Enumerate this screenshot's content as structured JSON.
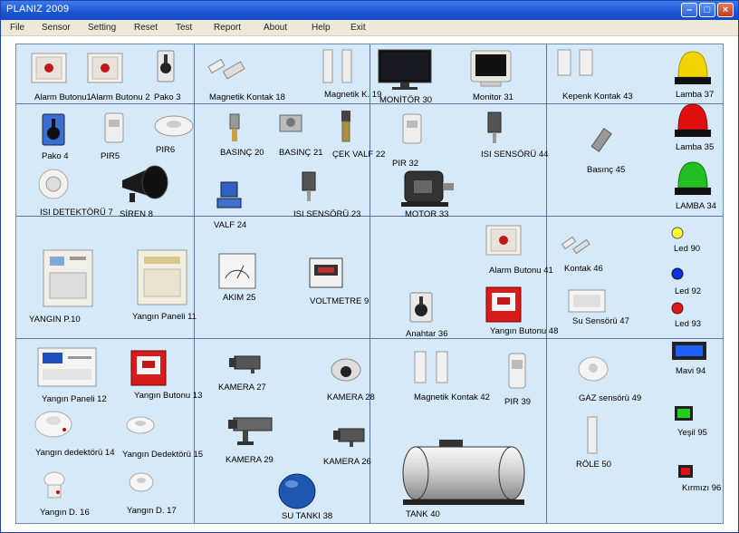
{
  "window": {
    "title": "PLANIZ  2009"
  },
  "menu": [
    "File",
    "Sensor",
    "Setting",
    "Reset",
    "Test",
    "Report",
    "About",
    "Help",
    "Exit"
  ],
  "devices": {
    "alarm_butonu_1": "Alarm Butonu1",
    "alarm_butonu_2": "Alarm Butonu 2",
    "pako_3": "Pako 3",
    "magnetik_kontak_18": "Magnetik Kontak 18",
    "magnetik_k_19": "Magnetik K. 19",
    "monitor_30": "MONİTÖR 30",
    "monitor_31": "Monitor 31",
    "kepenk_kontak_43": "Kepenk Kontak 43",
    "lamba_37": "Lamba 37",
    "pako_4": "Pako 4",
    "pir_5": "PIR5",
    "pir_6": "PIR6",
    "basinc_20": "BASINÇ 20",
    "basinc_21": "BASINÇ 21",
    "cek_valf_22": "ÇEK VALF 22",
    "pir_32": "PIR 32",
    "isi_sensoru_44": "ISI SENSÖRÜ 44",
    "basinc_45": "Basınç 45",
    "lamba_35": "Lamba 35",
    "isi_detektoru_7": "ISI DETEKTÖRÜ 7",
    "siren_8": "SİREN 8",
    "valf_24": "VALF 24",
    "isi_sensoru_23": "ISI SENSÖRÜ 23",
    "motor_33": "MOTOR 33",
    "lamba_34": "LAMBA 34",
    "yangin_p_10": "YANGIN P.10",
    "yangin_paneli_11": "Yangın Paneli 11",
    "akim_25": "AKIM 25",
    "voltmetre_9": "VOLTMETRE 9",
    "alarm_butonu_41": "Alarm Butonu 41",
    "kontak_46": "Kontak 46",
    "led_90": "Led 90",
    "led_92": "Led 92",
    "led_93": "Led 93",
    "su_sensoru_47": "Su Sensörü 47",
    "anahtar_36": "Anahtar 36",
    "yangin_butonu_48": "Yangın Butonu 48",
    "yangin_paneli_12": "Yangın Paneli 12",
    "yangin_butonu_13": "Yangın Butonu 13",
    "kamera_27": "KAMERA 27",
    "kamera_28": "KAMERA 28",
    "magnetik_kontak_42": "Magnetik Kontak 42",
    "pir_39": "PIR 39",
    "gaz_sensoru_49": "GAZ sensörü 49",
    "mavi_94": "Mavi 94",
    "yangin_dedektoru_14": "Yangın dedektörü 14",
    "yangin_dedektoru_15": "Yangın Dedektörü 15",
    "kamera_29": "KAMERA 29",
    "kamera_26": "KAMERA 26",
    "yesil_95": "Yeşil 95",
    "role_50": "RÖLE 50",
    "yangin_d_16": "Yangın D. 16",
    "yangin_d_17": "Yangın D. 17",
    "su_tanki_38": "SU TANKI 38",
    "tank_40": "TANK 40",
    "kirmizi_96": "Kırmızı 96"
  },
  "colors": {
    "panel_bg": "#d6e9f8",
    "lamp_yellow": "#f2d400",
    "lamp_red": "#e01010",
    "lamp_green": "#22c022",
    "led_yellow": "#ffff30",
    "led_blue": "#1030e0",
    "led_red": "#e01818",
    "mavi": "#2060ff",
    "yesil": "#20d020",
    "kirmizi": "#e01010"
  }
}
